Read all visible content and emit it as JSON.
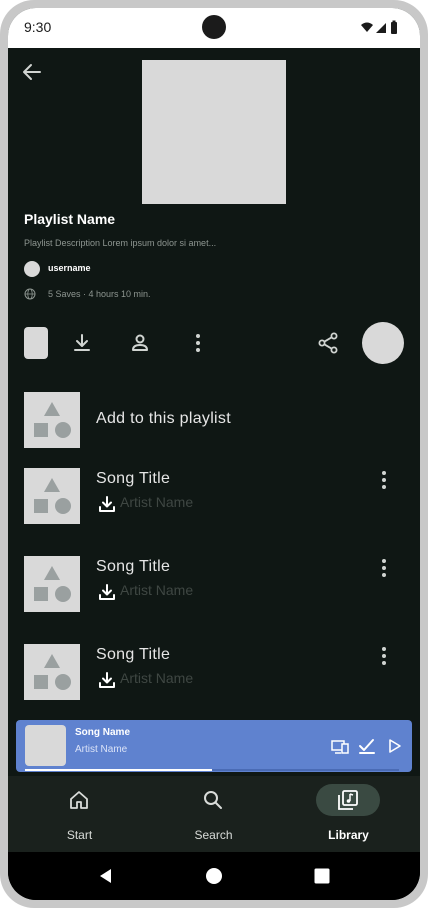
{
  "status_bar": {
    "time": "9:30"
  },
  "playlist": {
    "title": "Playlist Name",
    "description": "Playlist Description Lorem ipsum dolor si amet...",
    "owner": "username",
    "saves_info": "5 Saves · 4 hours 10 min."
  },
  "add_item": {
    "label": "Add to this playlist"
  },
  "songs": [
    {
      "title": "Song Title",
      "artist": "Artist Name"
    },
    {
      "title": "Song Title",
      "artist": "Artist Name"
    },
    {
      "title": "Song Title",
      "artist": "Artist Name"
    }
  ],
  "player": {
    "song": "Song Name",
    "artist": "Artist Name",
    "progress": 0.5
  },
  "nav": {
    "items": [
      {
        "label": "Start",
        "icon": "home-icon"
      },
      {
        "label": "Search",
        "icon": "search-icon"
      },
      {
        "label": "Library",
        "icon": "library-icon",
        "active": true
      }
    ]
  },
  "colors": {
    "background": "#0f1714",
    "player": "#5f82cf",
    "nav_active_pill": "#3a4a42",
    "placeholder": "#d9d9d9"
  }
}
